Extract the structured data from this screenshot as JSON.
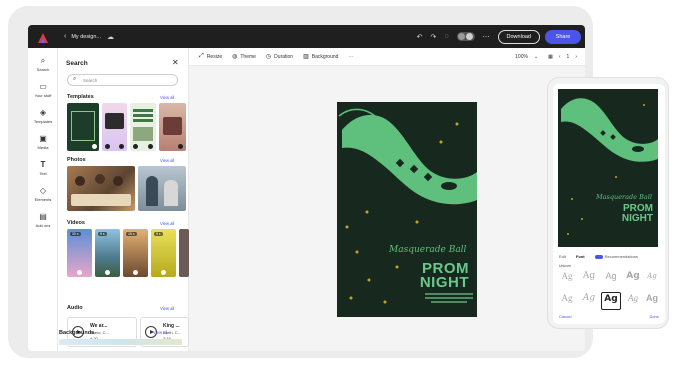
{
  "topbar": {
    "title": "My design...",
    "download_label": "Download",
    "share_label": "Share"
  },
  "rail": [
    {
      "icon": "search-icon",
      "label": "Search"
    },
    {
      "icon": "folder-icon",
      "label": "Your stuff"
    },
    {
      "icon": "templates-icon",
      "label": "Templates"
    },
    {
      "icon": "media-icon",
      "label": "Media"
    },
    {
      "icon": "text-icon",
      "label": "Text"
    },
    {
      "icon": "elements-icon",
      "label": "Elements"
    },
    {
      "icon": "add-ons-icon",
      "label": "Add ons"
    }
  ],
  "panel": {
    "title": "Search",
    "search_placeholder": "Search",
    "view_all": "View all",
    "sections": {
      "templates": "Templates",
      "photos": "Photos",
      "videos": "Videos",
      "audio": "Audio",
      "backgrounds": "Backgrounds"
    },
    "videos": [
      {
        "duration": "30 s"
      },
      {
        "duration": "9 s"
      },
      {
        "duration": "16 s"
      },
      {
        "duration": "9 s"
      }
    ],
    "audio": [
      {
        "title": "We ar...",
        "artist": "Bravo, C...",
        "duration": "4:20"
      },
      {
        "title": "King ...",
        "artist": "Earth, C...",
        "duration": "2:15"
      }
    ]
  },
  "toolbar": {
    "resize": "Resize",
    "theme": "Theme",
    "duration": "Duration",
    "background": "Background",
    "zoom": "100%",
    "page": "1"
  },
  "poster": {
    "script_title": "Masquerade Ball",
    "line1": "PROM",
    "line2": "NIGHT"
  },
  "phone": {
    "tabs": [
      "Edit",
      "Font",
      "Recommendations"
    ],
    "subheading": "Unicorn",
    "font_sample": "Ag",
    "cancel": "Cancel",
    "done": "Done"
  },
  "colors": {
    "accent": "#4b56e8",
    "poster_bg": "#17291f",
    "poster_green": "#6bc88b",
    "topbar": "#1f1f1f"
  }
}
